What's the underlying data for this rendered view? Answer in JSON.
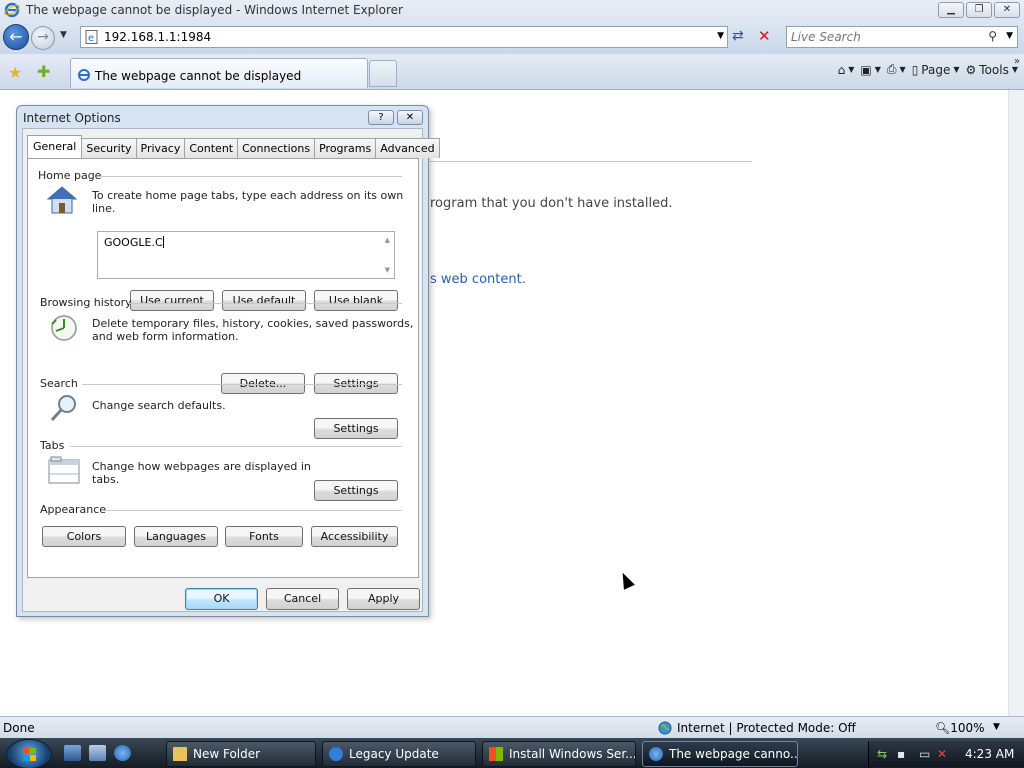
{
  "window": {
    "title": "The webpage cannot be displayed - Windows Internet Explorer"
  },
  "address": {
    "url": "192.168.1.1:1984"
  },
  "search": {
    "placeholder": "Live Search"
  },
  "tab": {
    "title": "The webpage cannot be displayed"
  },
  "commands": {
    "page": "Page",
    "tools": "Tools"
  },
  "page": {
    "error_line": "rogram that you don't have installed.",
    "link_fragment": "s web content."
  },
  "status": {
    "left": "Done",
    "zone": "Internet | Protected Mode: Off",
    "zoom": "100%"
  },
  "dialog": {
    "title": "Internet Options",
    "tabs": [
      "General",
      "Security",
      "Privacy",
      "Content",
      "Connections",
      "Programs",
      "Advanced"
    ],
    "homepage": {
      "label": "Home page",
      "desc": "To create home page tabs, type each address on its own line.",
      "value": "GOOGLE.C",
      "use_current": "Use current",
      "use_default": "Use default",
      "use_blank": "Use blank"
    },
    "history": {
      "label": "Browsing history",
      "desc_line1": "Delete temporary files, history, cookies, saved passwords,",
      "desc_line2": "and web form information.",
      "delete": "Delete...",
      "settings": "Settings"
    },
    "search": {
      "label": "Search",
      "desc": "Change search defaults.",
      "settings": "Settings"
    },
    "tabs_group": {
      "label": "Tabs",
      "desc_line1": "Change how webpages are displayed in",
      "desc_line2": "tabs.",
      "settings": "Settings"
    },
    "appearance": {
      "label": "Appearance",
      "colors": "Colors",
      "languages": "Languages",
      "fonts": "Fonts",
      "accessibility": "Accessibility"
    },
    "ok": "OK",
    "cancel": "Cancel",
    "apply": "Apply"
  },
  "taskbar": {
    "buttons": [
      "New Folder",
      "Legacy Update",
      "Install Windows Ser...",
      "The webpage canno..."
    ],
    "clock": "4:23 AM"
  }
}
